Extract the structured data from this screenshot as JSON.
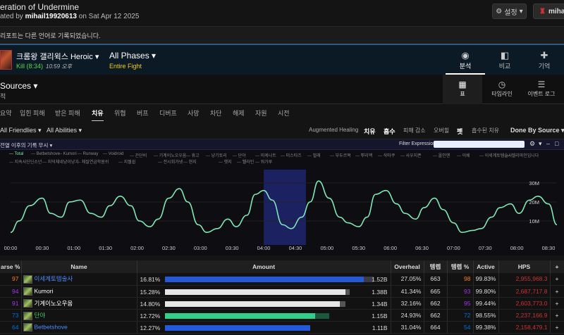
{
  "header": {
    "title": "eration of Undermine",
    "sub_prefix": "ated by",
    "user": "mihail19920613",
    "sub_mid": "on",
    "date": "Sat Apr 12 2025",
    "settings_label": "설정",
    "user_label": "miha"
  },
  "notice": "리포트는 다른 언어로 기록되었습니다.",
  "fight": {
    "boss": "크롬왕 갤리윅스 Heroic",
    "kill": "Kill (8:34)",
    "time": "10:59 오후",
    "phase": "All Phases",
    "phase_sub": "Entire Fight",
    "tabs": [
      {
        "label": "분석",
        "icon": "eye-icon"
      },
      {
        "label": "비교",
        "icon": "compare-icon"
      },
      {
        "label": "기억",
        "icon": "puzzle-icon"
      }
    ]
  },
  "view": {
    "sources": "Sources",
    "sources_sub": "적",
    "tabs": [
      {
        "label": "표",
        "icon": "table-icon"
      },
      {
        "label": "타임라인",
        "icon": "clock-icon"
      },
      {
        "label": "이벤트 로그",
        "icon": "list-icon"
      }
    ]
  },
  "categories": [
    "요약",
    "입힌 피해",
    "받은 피해",
    "치유",
    "위협",
    "버프",
    "디버프",
    "사망",
    "차단",
    "해제",
    "자원",
    "시전"
  ],
  "filters": {
    "friendlies": "All Friendlies",
    "abilities": "All Abilities",
    "right": [
      "Augmented Healing",
      "치유",
      "흡수",
      "피해 감소",
      "오버힐",
      "펫",
      "흡수된 치유"
    ],
    "done_by": "Done By Source"
  },
  "chart_header": {
    "label": "전열 이후의 기록 무시",
    "filter_label": "Filter Expression:",
    "filter_value": ""
  },
  "legend": [
    "Total",
    "Betbetshove",
    "Kumori",
    "Runway",
    "Voidroid",
    "끈단비",
    "기계이노오우움",
    "휴고",
    "냥기토리",
    "단야",
    "미케나트",
    "미스타즈",
    "벌래",
    "부두르복",
    "뿌리맥",
    "삭마쿠",
    "사우지폰",
    "올인맨",
    "이쉐",
    "이세계토템술사",
    "젤리마인입니다",
    "지속사딘딘소년",
    "지덕체네냥이냥기",
    "체질연금학원쉬",
    "지쉘쉽",
    "전시회가넷",
    "현지",
    "햇지",
    "웰라인",
    "워가루"
  ],
  "chart_data": {
    "type": "line",
    "title": "",
    "xlabel": "",
    "ylabel": "",
    "x_ticks": [
      "00:00",
      "00:30",
      "01:00",
      "01:30",
      "02:00",
      "02:30",
      "03:00",
      "03:30",
      "04:00",
      "04:30",
      "05:00",
      "05:30",
      "06:00",
      "06:30",
      "07:00",
      "07:30",
      "08:00",
      "08:30"
    ],
    "y_ticks": [
      "10M",
      "20M",
      "30M"
    ],
    "ylim": [
      0,
      37
    ],
    "xlim": [
      0,
      518
    ],
    "highlight": [
      240,
      280
    ],
    "series": [
      {
        "name": "Total",
        "x": [
          0,
          8,
          18,
          30,
          38,
          48,
          56,
          66,
          76,
          86,
          94,
          104,
          114,
          122,
          132,
          140,
          150,
          160,
          168,
          178,
          186,
          196,
          206,
          214,
          224,
          232,
          240,
          248,
          258,
          266,
          276,
          284,
          292,
          302,
          312,
          320,
          330,
          338,
          346,
          356,
          366,
          374,
          384,
          392,
          402,
          410,
          420,
          428,
          438,
          446,
          456,
          464,
          474,
          482,
          492,
          500,
          510,
          518
        ],
        "y": [
          4,
          10,
          18,
          22,
          14,
          12,
          20,
          21,
          14,
          12,
          18,
          23,
          18,
          10,
          7,
          11,
          22,
          27,
          20,
          8,
          4,
          6,
          11,
          7,
          13,
          24,
          26,
          21,
          8,
          6,
          12,
          20,
          31,
          22,
          12,
          9,
          7,
          12,
          24,
          26,
          19,
          14,
          11,
          17,
          22,
          16,
          9,
          4,
          5,
          6,
          12,
          17,
          19,
          14,
          21,
          23,
          19,
          8
        ]
      }
    ]
  },
  "table": {
    "columns": [
      "arse %",
      "Name",
      "Amount",
      "Overheal",
      "템렙",
      "템렙 %",
      "Active",
      "HPS",
      "+"
    ],
    "rows": [
      {
        "parse": "97",
        "parse_color": "#ff8000",
        "name": "이세계토템술사",
        "name_color": "#4a8cff",
        "pct": "16.81%",
        "bar": 1.0,
        "bar_color": "#2459d9",
        "bar2": 0.05,
        "bar2_color": "#3a3a4a",
        "amount": "1.52B",
        "overheal": "27.05%",
        "ilvl": "663",
        "ilvl_pct": "98",
        "ilvl_pct_color": "#ff8000",
        "active": "99.83%",
        "hps": "2,955,968.3",
        "hps_color": "#cc3333"
      },
      {
        "parse": "94",
        "parse_color": "#a335ee",
        "name": "Kumori",
        "name_color": "#ffffff",
        "pct": "15.28%",
        "bar": 0.909,
        "bar_color": "#e6e6e6",
        "bar2": 0.02,
        "bar2_color": "#555555",
        "amount": "1.38B",
        "overheal": "41.34%",
        "ilvl": "665",
        "ilvl_pct": "93",
        "ilvl_pct_color": "#a335ee",
        "active": "99.80%",
        "hps": "2,687,717.8",
        "hps_color": "#cc3333"
      },
      {
        "parse": "91",
        "parse_color": "#a335ee",
        "name": "기계이노오우움",
        "name_color": "#ffffff",
        "pct": "14.80%",
        "bar": 0.88,
        "bar_color": "#e6e6e6",
        "bar2": 0.03,
        "bar2_color": "#555555",
        "amount": "1.34B",
        "overheal": "32.16%",
        "ilvl": "662",
        "ilvl_pct": "95",
        "ilvl_pct_color": "#a335ee",
        "active": "99.44%",
        "hps": "2,603,773.0",
        "hps_color": "#cc3333"
      },
      {
        "parse": "73",
        "parse_color": "#0070dd",
        "name": "단야",
        "name_color": "#33cc66",
        "pct": "12.72%",
        "bar": 0.757,
        "bar_color": "#2fd18a",
        "bar2": 0.07,
        "bar2_color": "#1a5a3a",
        "amount": "1.15B",
        "overheal": "24.93%",
        "ilvl": "662",
        "ilvl_pct": "72",
        "ilvl_pct_color": "#0070dd",
        "active": "98.55%",
        "hps": "2,237,166.9",
        "hps_color": "#cc3333"
      },
      {
        "parse": "64",
        "parse_color": "#0070dd",
        "name": "Betbetshove",
        "name_color": "#4a8cff",
        "pct": "12.27%",
        "bar": 0.73,
        "bar_color": "#2459d9",
        "bar2": 0.0,
        "bar2_color": "#3a3a4a",
        "amount": "1.11B",
        "overheal": "31.04%",
        "ilvl": "664",
        "ilvl_pct": "54",
        "ilvl_pct_color": "#0070dd",
        "active": "99.38%",
        "hps": "2,158,479.1",
        "hps_color": "#cc3333"
      }
    ]
  }
}
